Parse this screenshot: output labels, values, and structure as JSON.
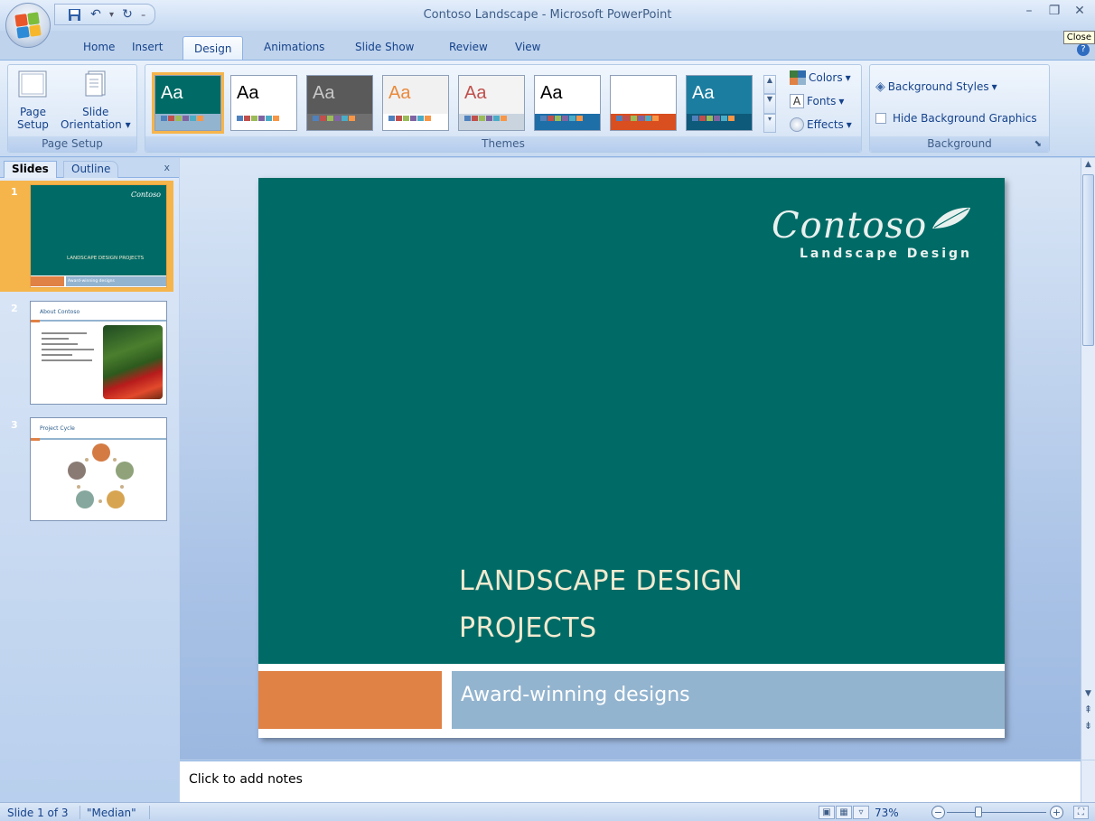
{
  "window": {
    "title": "Contoso Landscape - Microsoft PowerPoint",
    "close_tooltip": "Close"
  },
  "tabs": [
    {
      "label": "Home",
      "active": false
    },
    {
      "label": "Insert",
      "active": false
    },
    {
      "label": "Design",
      "active": true
    },
    {
      "label": "Animations",
      "active": false
    },
    {
      "label": "Slide Show",
      "active": false
    },
    {
      "label": "Review",
      "active": false
    },
    {
      "label": "View",
      "active": false
    }
  ],
  "ribbon": {
    "page_setup": {
      "group_label": "Page Setup",
      "page_setup_label_1": "Page",
      "page_setup_label_2": "Setup",
      "orientation_label_1": "Slide",
      "orientation_label_2": "Orientation"
    },
    "themes": {
      "group_label": "Themes",
      "aa": "Aa",
      "items": [
        {
          "bg": "#006b66",
          "fg": "#ffffff",
          "bar": "#93b4cf",
          "selected": true
        },
        {
          "bg": "#ffffff",
          "fg": "#000000",
          "bar": "#ffffff",
          "selected": false
        },
        {
          "bg": "#5a5a5a",
          "fg": "#c8c8c8",
          "bar": "#6f6f6f",
          "selected": false
        },
        {
          "bg": "#f1f1f1",
          "fg": "#e98a3c",
          "bar": "#ffffff",
          "selected": false
        },
        {
          "bg": "#f3f3f3",
          "fg": "#c0504d",
          "bar": "#c9d4df",
          "selected": false
        },
        {
          "bg": "#ffffff",
          "fg": "#000000",
          "bar": "#1e6fa7",
          "selected": false
        },
        {
          "bg": "#ffffff",
          "fg": "#ffffff",
          "bar": "#d94f1f",
          "selected": false
        },
        {
          "bg": "#1b7ea1",
          "fg": "#ffffff",
          "bar": "#0e5a7a",
          "selected": false
        }
      ],
      "colors_label": "Colors",
      "fonts_label": "Fonts",
      "effects_label": "Effects"
    },
    "background": {
      "group_label": "Background",
      "styles_label": "Background Styles",
      "hide_label": "Hide Background Graphics",
      "hide_checked": false
    }
  },
  "left_pane": {
    "tab_slides": "Slides",
    "tab_outline": "Outline",
    "close": "x",
    "slides": [
      {
        "number": "1",
        "title": "LANDSCAPE DESIGN PROJECTS",
        "subtitle": "Award-winning designs",
        "logo": "Contoso"
      },
      {
        "number": "2",
        "title": "About Contoso"
      },
      {
        "number": "3",
        "title": "Project Cycle"
      }
    ]
  },
  "slide": {
    "logo_script": "Contoso",
    "logo_tagline": "Landscape Design",
    "title_line1": "LANDSCAPE DESIGN",
    "title_line2": "PROJECTS",
    "subtitle": "Award-winning designs",
    "colors": {
      "background": "#006b66",
      "title": "#f2ead0",
      "orange": "#e08145",
      "blue": "#93b4cf"
    }
  },
  "notes": {
    "placeholder": "Click to add notes"
  },
  "statusbar": {
    "slide_info": "Slide 1 of 3",
    "theme_name": "\"Median\"",
    "zoom": "73%"
  }
}
